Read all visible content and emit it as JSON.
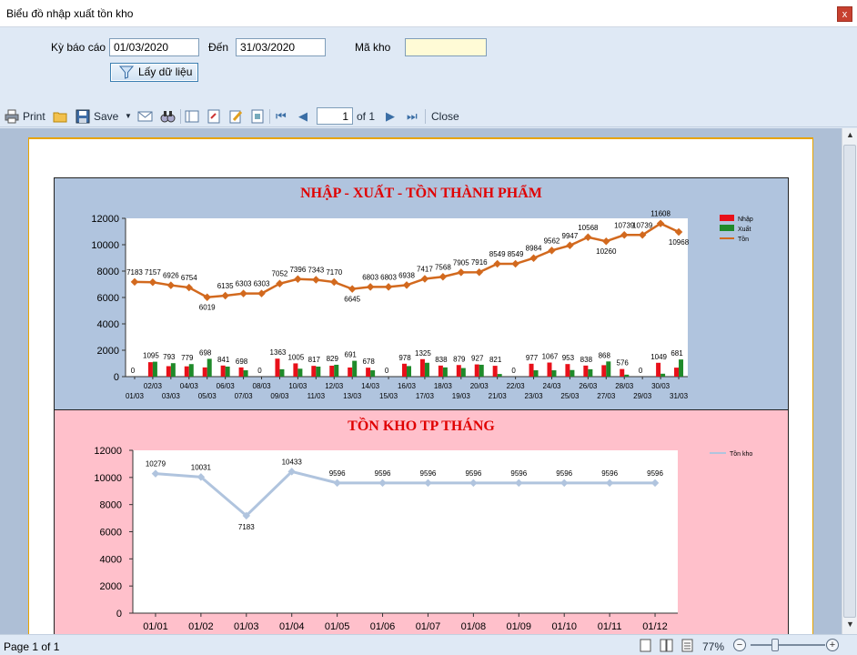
{
  "window": {
    "title": "Biểu đồ nhập xuất tồn kho",
    "close_glyph": "x"
  },
  "filter": {
    "report_period_label": "Kỳ báo cáo",
    "from_value": "01/03/2020",
    "to_label": "Đến",
    "to_value": "31/03/2020",
    "warehouse_label": "Mã kho",
    "warehouse_value": "",
    "fetch_button": "Lấy dữ liệu"
  },
  "toolbar": {
    "print_label": "Print",
    "save_label": "Save",
    "page_value": "1",
    "page_of": "of 1",
    "close_label": "Close"
  },
  "status": {
    "page_text": "Page 1 of 1",
    "zoom": "77%"
  },
  "colors": {
    "nhap": "#e8101a",
    "xuat": "#1f8a2a",
    "ton": "#d2691e",
    "tonkho": "#b0c4de",
    "chart_title": "#e00000"
  },
  "chart_data": [
    {
      "type": "bar",
      "title": "NHẬP - XUẤT - TỒN THÀNH PHẨM",
      "ylim": [
        0,
        12000
      ],
      "yticks": [
        "12000",
        "10000",
        "8000",
        "6000",
        "4000",
        "2000",
        "0"
      ],
      "legend": "top-right",
      "categories": [
        "01/03",
        "02/03",
        "03/03",
        "04/03",
        "05/03",
        "06/03",
        "07/03",
        "08/03",
        "09/03",
        "10/03",
        "11/03",
        "12/03",
        "13/03",
        "14/03",
        "15/03",
        "16/03",
        "17/03",
        "18/03",
        "19/03",
        "20/03",
        "21/03",
        "22/03",
        "23/03",
        "24/03",
        "25/03",
        "26/03",
        "27/03",
        "28/03",
        "29/03",
        "30/03",
        "31/03"
      ],
      "series": [
        {
          "name": "Nhập",
          "values": [
            0,
            1095,
            793,
            779,
            698,
            841,
            698,
            0,
            1363,
            1005,
            817,
            829,
            691,
            678,
            0,
            978,
            1325,
            838,
            879,
            927,
            821,
            0,
            977,
            1067,
            953,
            838,
            868,
            576,
            0,
            1049,
            681
          ]
        },
        {
          "name": "Xuất",
          "values": [
            0,
            1130,
            1020,
            950,
            1350,
            760,
            480,
            0,
            560,
            600,
            760,
            900,
            1200,
            480,
            0,
            800,
            1050,
            700,
            650,
            900,
            200,
            0,
            480,
            480,
            500,
            560,
            1150,
            150,
            0,
            220,
            1300
          ]
        },
        {
          "name": "Tồn",
          "values": [
            7183,
            7157,
            6926,
            6754,
            6019,
            6135,
            6303,
            6303,
            7052,
            7396,
            7343,
            7170,
            6645,
            6803,
            6803,
            6938,
            7417,
            7568,
            7905,
            7916,
            8549,
            8549,
            8984,
            9562,
            9947,
            10568,
            10260,
            10739,
            10739,
            11608,
            10968
          ]
        }
      ]
    },
    {
      "type": "line",
      "title": "TỒN KHO TP THÁNG",
      "ylim": [
        0,
        12000
      ],
      "yticks": [
        "12000",
        "10000",
        "8000",
        "6000",
        "4000",
        "2000",
        "0"
      ],
      "legend": "top-right",
      "categories": [
        "01/01",
        "01/02",
        "01/03",
        "01/04",
        "01/05",
        "01/06",
        "01/07",
        "01/08",
        "01/09",
        "01/10",
        "01/11",
        "01/12"
      ],
      "series": [
        {
          "name": "Tồn kho",
          "values": [
            10279,
            10031,
            7183,
            10433,
            9596,
            9596,
            9596,
            9596,
            9596,
            9596,
            9596,
            9596
          ]
        }
      ]
    }
  ]
}
